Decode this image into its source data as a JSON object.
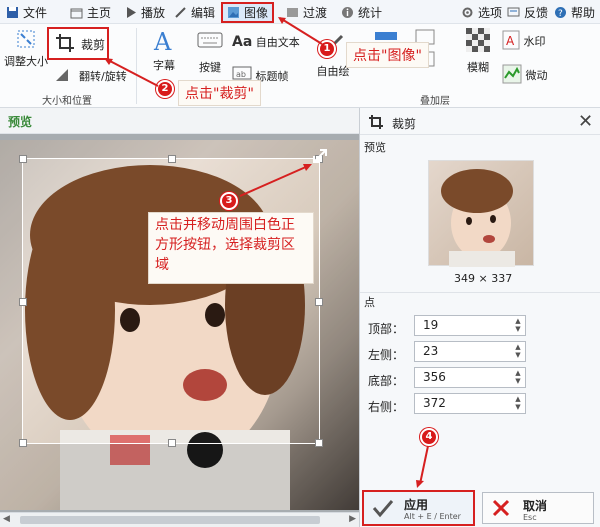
{
  "menu": {
    "file": "文件",
    "home": "主页",
    "play": "播放",
    "edit": "编辑",
    "image": "图像",
    "transition": "过渡",
    "stats": "统计",
    "options": "选项",
    "feedback": "反馈",
    "help": "帮助"
  },
  "ribbon": {
    "resize": "调整大小",
    "crop": "裁剪",
    "rotate": "翻转/旋转",
    "group_size": "大小和位置",
    "caption": "字幕",
    "keys": "按键",
    "free_text": "自由文本",
    "title_frame": "标题帧",
    "free_draw": "自由绘",
    "overlay_group": "叠加层",
    "blur": "模糊",
    "watermark": "水印",
    "jitter": "微动"
  },
  "annotations": {
    "step1_label": "点击\"图像\"",
    "step2_label": "点击\"裁剪\"",
    "step3_text": "点击并移动周围白色正方形按钮，选择裁剪区域",
    "badge1": "1",
    "badge2": "2",
    "badge3": "3",
    "badge4": "4"
  },
  "preview": {
    "title": "预览"
  },
  "panel": {
    "title": "裁剪",
    "preview_label": "预览",
    "dimensions": "349 × 337",
    "points_label": "点",
    "top_label": "顶部：",
    "top_value": "19",
    "left_label": "左侧：",
    "left_value": "23",
    "bottom_label": "底部：",
    "bottom_value": "356",
    "right_label": "右侧：",
    "right_value": "372"
  },
  "buttons": {
    "apply": "应用",
    "apply_shortcut": "Alt + E / Enter",
    "cancel": "取消",
    "cancel_shortcut": "Esc"
  },
  "colors": {
    "accent": "#2b73c8",
    "annotation_red": "#d62020"
  }
}
